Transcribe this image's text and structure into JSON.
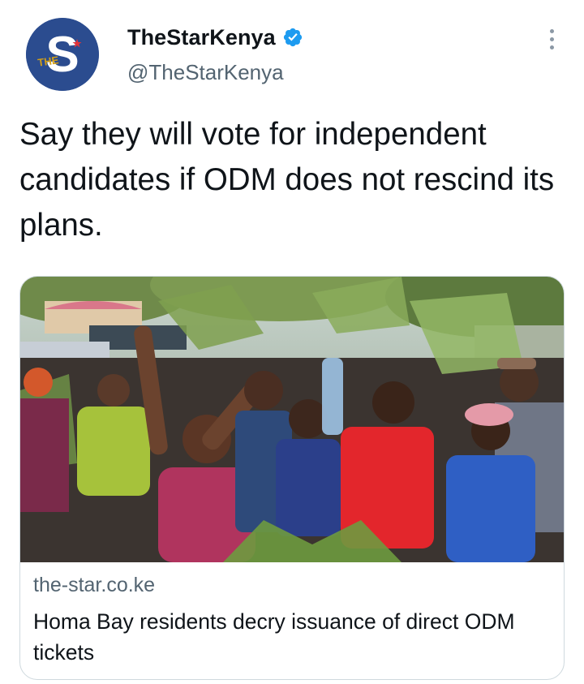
{
  "tweet": {
    "author": {
      "display_name": "TheStarKenya",
      "handle": "@TheStarKenya",
      "verified": true,
      "avatar_icon": "the-star-logo",
      "avatar_color": "#2b4c8f"
    },
    "text": "Say they will vote for independent candidates if ODM does not rescind its plans.",
    "more_icon": "more-options-icon",
    "card": {
      "domain": "the-star.co.ke",
      "title": "Homa Bay residents decry issuance of direct ODM tickets"
    }
  },
  "colors": {
    "text_primary": "#0f1419",
    "text_secondary": "#536471",
    "verified_blue": "#1d9bf0",
    "card_border": "#cfd9de"
  }
}
